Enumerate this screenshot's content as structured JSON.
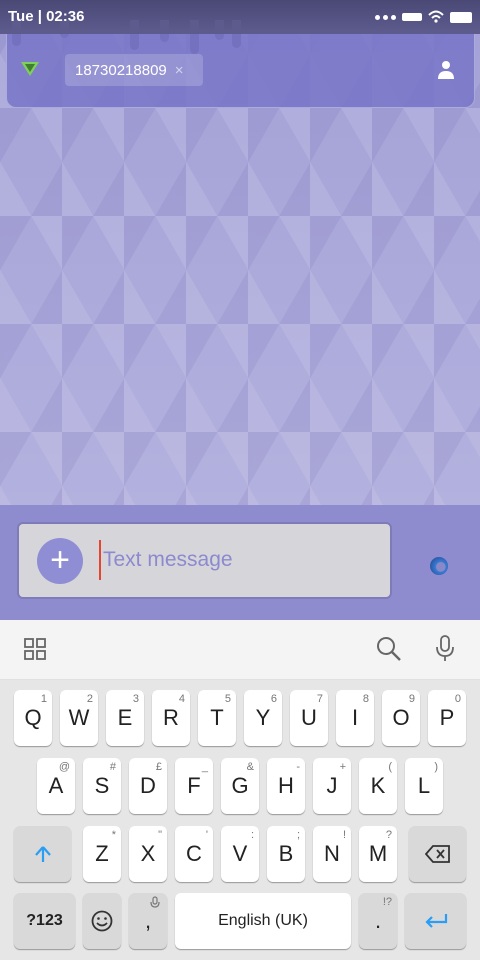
{
  "status_bar": {
    "time": "Tue | 02:36"
  },
  "recipient": {
    "number": "18730218809",
    "remove_glyph": "×"
  },
  "compose": {
    "placeholder": "Text message",
    "attach_glyph": "+"
  },
  "keyboard": {
    "row1": [
      {
        "label": "Q",
        "hint": "1"
      },
      {
        "label": "W",
        "hint": "2"
      },
      {
        "label": "E",
        "hint": "3"
      },
      {
        "label": "R",
        "hint": "4"
      },
      {
        "label": "T",
        "hint": "5"
      },
      {
        "label": "Y",
        "hint": "6"
      },
      {
        "label": "U",
        "hint": "7"
      },
      {
        "label": "I",
        "hint": "8"
      },
      {
        "label": "O",
        "hint": "9"
      },
      {
        "label": "P",
        "hint": "0"
      }
    ],
    "row2": [
      {
        "label": "A",
        "hint": "@"
      },
      {
        "label": "S",
        "hint": "#"
      },
      {
        "label": "D",
        "hint": "£"
      },
      {
        "label": "F",
        "hint": "_"
      },
      {
        "label": "G",
        "hint": "&"
      },
      {
        "label": "H",
        "hint": "-"
      },
      {
        "label": "J",
        "hint": "+"
      },
      {
        "label": "K",
        "hint": "("
      },
      {
        "label": "L",
        "hint": ")"
      }
    ],
    "row3": [
      {
        "label": "Z",
        "hint": "*"
      },
      {
        "label": "X",
        "hint": "\""
      },
      {
        "label": "C",
        "hint": "'"
      },
      {
        "label": "V",
        "hint": ":"
      },
      {
        "label": "B",
        "hint": ";"
      },
      {
        "label": "N",
        "hint": "!"
      },
      {
        "label": "M",
        "hint": "?"
      }
    ],
    "symbols_label": "?123",
    "comma_label": ",",
    "space_label": "English (UK)",
    "period_label": ".",
    "period_hint": "!?"
  },
  "colors": {
    "accent": "#8f8dd4",
    "compose_bg": "#8e8ccf",
    "enter_blue": "#2a9df4"
  },
  "icons": {
    "app_logo": "app-logo-icon",
    "contact": "person-icon",
    "apps": "grid-icon",
    "search": "search-icon",
    "mic": "mic-icon",
    "shift": "shift-arrow-icon",
    "backspace": "backspace-icon",
    "emoji": "smiley-icon",
    "enter": "enter-arrow-icon",
    "send": "send-icon"
  }
}
